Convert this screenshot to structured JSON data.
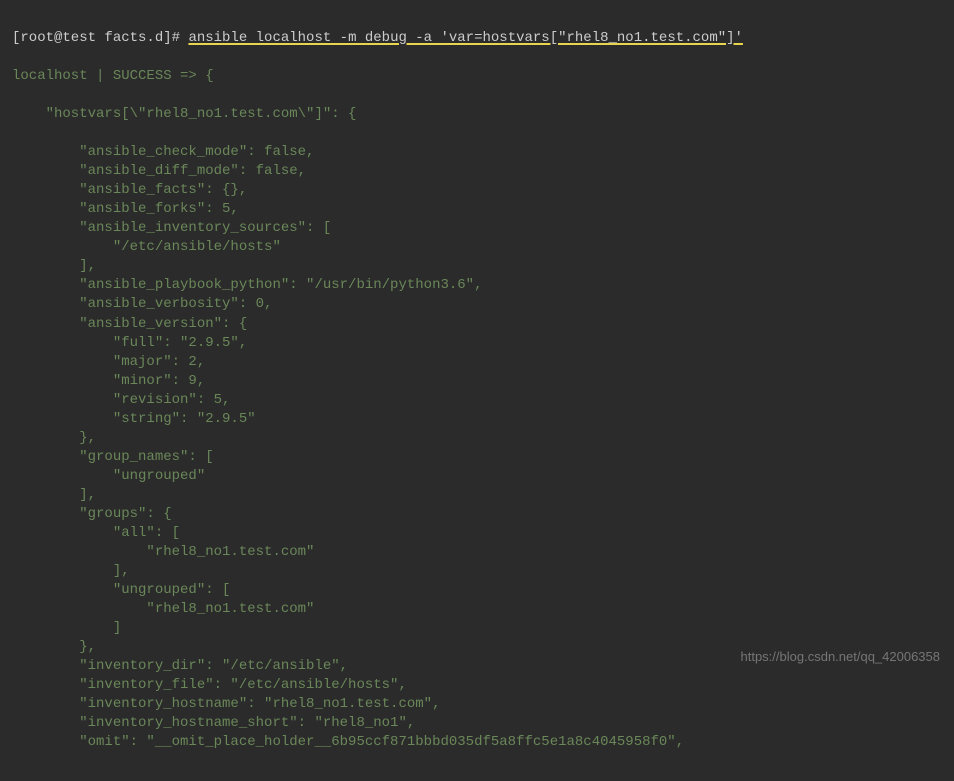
{
  "prompt": {
    "user_host": "[root@test facts.d]# ",
    "command": "ansible localhost -m debug -a 'var=hostvars[\"rhel8_no1.test.com\"]'"
  },
  "output": {
    "status_line": "localhost | SUCCESS => {",
    "hostvars_key": "    \"hostvars[\\\"rhel8_no1.test.com\\\"]\": {",
    "lines": [
      {
        "indent": "        ",
        "key": "\"ansible_check_mode\"",
        "sep": ": ",
        "value": "false",
        "comma": ","
      },
      {
        "indent": "        ",
        "key": "\"ansible_diff_mode\"",
        "sep": ": ",
        "value": "false",
        "comma": ","
      },
      {
        "indent": "        ",
        "key": "\"ansible_facts\"",
        "sep": ": ",
        "value": "{}",
        "comma": ","
      },
      {
        "indent": "        ",
        "key": "\"ansible_forks\"",
        "sep": ": ",
        "value": "5",
        "comma": ","
      },
      {
        "indent": "        ",
        "key": "\"ansible_inventory_sources\"",
        "sep": ": ",
        "value": "[",
        "comma": ""
      },
      {
        "indent": "            ",
        "key": "",
        "sep": "",
        "value": "\"/etc/ansible/hosts\"",
        "comma": ""
      },
      {
        "indent": "        ",
        "key": "",
        "sep": "",
        "value": "]",
        "comma": ","
      },
      {
        "indent": "        ",
        "key": "\"ansible_playbook_python\"",
        "sep": ": ",
        "value": "\"/usr/bin/python3.6\"",
        "comma": ","
      },
      {
        "indent": "        ",
        "key": "\"ansible_verbosity\"",
        "sep": ": ",
        "value": "0",
        "comma": ","
      },
      {
        "indent": "        ",
        "key": "\"ansible_version\"",
        "sep": ": ",
        "value": "{",
        "comma": ""
      },
      {
        "indent": "            ",
        "key": "\"full\"",
        "sep": ": ",
        "value": "\"2.9.5\"",
        "comma": ","
      },
      {
        "indent": "            ",
        "key": "\"major\"",
        "sep": ": ",
        "value": "2",
        "comma": ","
      },
      {
        "indent": "            ",
        "key": "\"minor\"",
        "sep": ": ",
        "value": "9",
        "comma": ","
      },
      {
        "indent": "            ",
        "key": "\"revision\"",
        "sep": ": ",
        "value": "5",
        "comma": ","
      },
      {
        "indent": "            ",
        "key": "\"string\"",
        "sep": ": ",
        "value": "\"2.9.5\"",
        "comma": ""
      },
      {
        "indent": "        ",
        "key": "",
        "sep": "",
        "value": "}",
        "comma": ","
      },
      {
        "indent": "        ",
        "key": "\"group_names\"",
        "sep": ": ",
        "value": "[",
        "comma": ""
      },
      {
        "indent": "            ",
        "key": "",
        "sep": "",
        "value": "\"ungrouped\"",
        "comma": ""
      },
      {
        "indent": "        ",
        "key": "",
        "sep": "",
        "value": "]",
        "comma": ","
      },
      {
        "indent": "        ",
        "key": "\"groups\"",
        "sep": ": ",
        "value": "{",
        "comma": ""
      },
      {
        "indent": "            ",
        "key": "\"all\"",
        "sep": ": ",
        "value": "[",
        "comma": ""
      },
      {
        "indent": "                ",
        "key": "",
        "sep": "",
        "value": "\"rhel8_no1.test.com\"",
        "comma": ""
      },
      {
        "indent": "            ",
        "key": "",
        "sep": "",
        "value": "]",
        "comma": ","
      },
      {
        "indent": "            ",
        "key": "\"ungrouped\"",
        "sep": ": ",
        "value": "[",
        "comma": ""
      },
      {
        "indent": "                ",
        "key": "",
        "sep": "",
        "value": "\"rhel8_no1.test.com\"",
        "comma": ""
      },
      {
        "indent": "            ",
        "key": "",
        "sep": "",
        "value": "]",
        "comma": ""
      },
      {
        "indent": "        ",
        "key": "",
        "sep": "",
        "value": "}",
        "comma": ","
      },
      {
        "indent": "        ",
        "key": "\"inventory_dir\"",
        "sep": ": ",
        "value": "\"/etc/ansible\"",
        "comma": ","
      },
      {
        "indent": "        ",
        "key": "\"inventory_file\"",
        "sep": ": ",
        "value": "\"/etc/ansible/hosts\"",
        "comma": ","
      },
      {
        "indent": "        ",
        "key": "\"inventory_hostname\"",
        "sep": ": ",
        "value": "\"rhel8_no1.test.com\"",
        "comma": ","
      },
      {
        "indent": "        ",
        "key": "\"inventory_hostname_short\"",
        "sep": ": ",
        "value": "\"rhel8_no1\"",
        "comma": ","
      },
      {
        "indent": "        ",
        "key": "\"omit\"",
        "sep": ": ",
        "value": "\"__omit_place_holder__6b95ccf871bbbd035df5a8ffc5e1a8c4045958f0\"",
        "comma": ","
      }
    ]
  },
  "watermark": "https://blog.csdn.net/qq_42006358"
}
